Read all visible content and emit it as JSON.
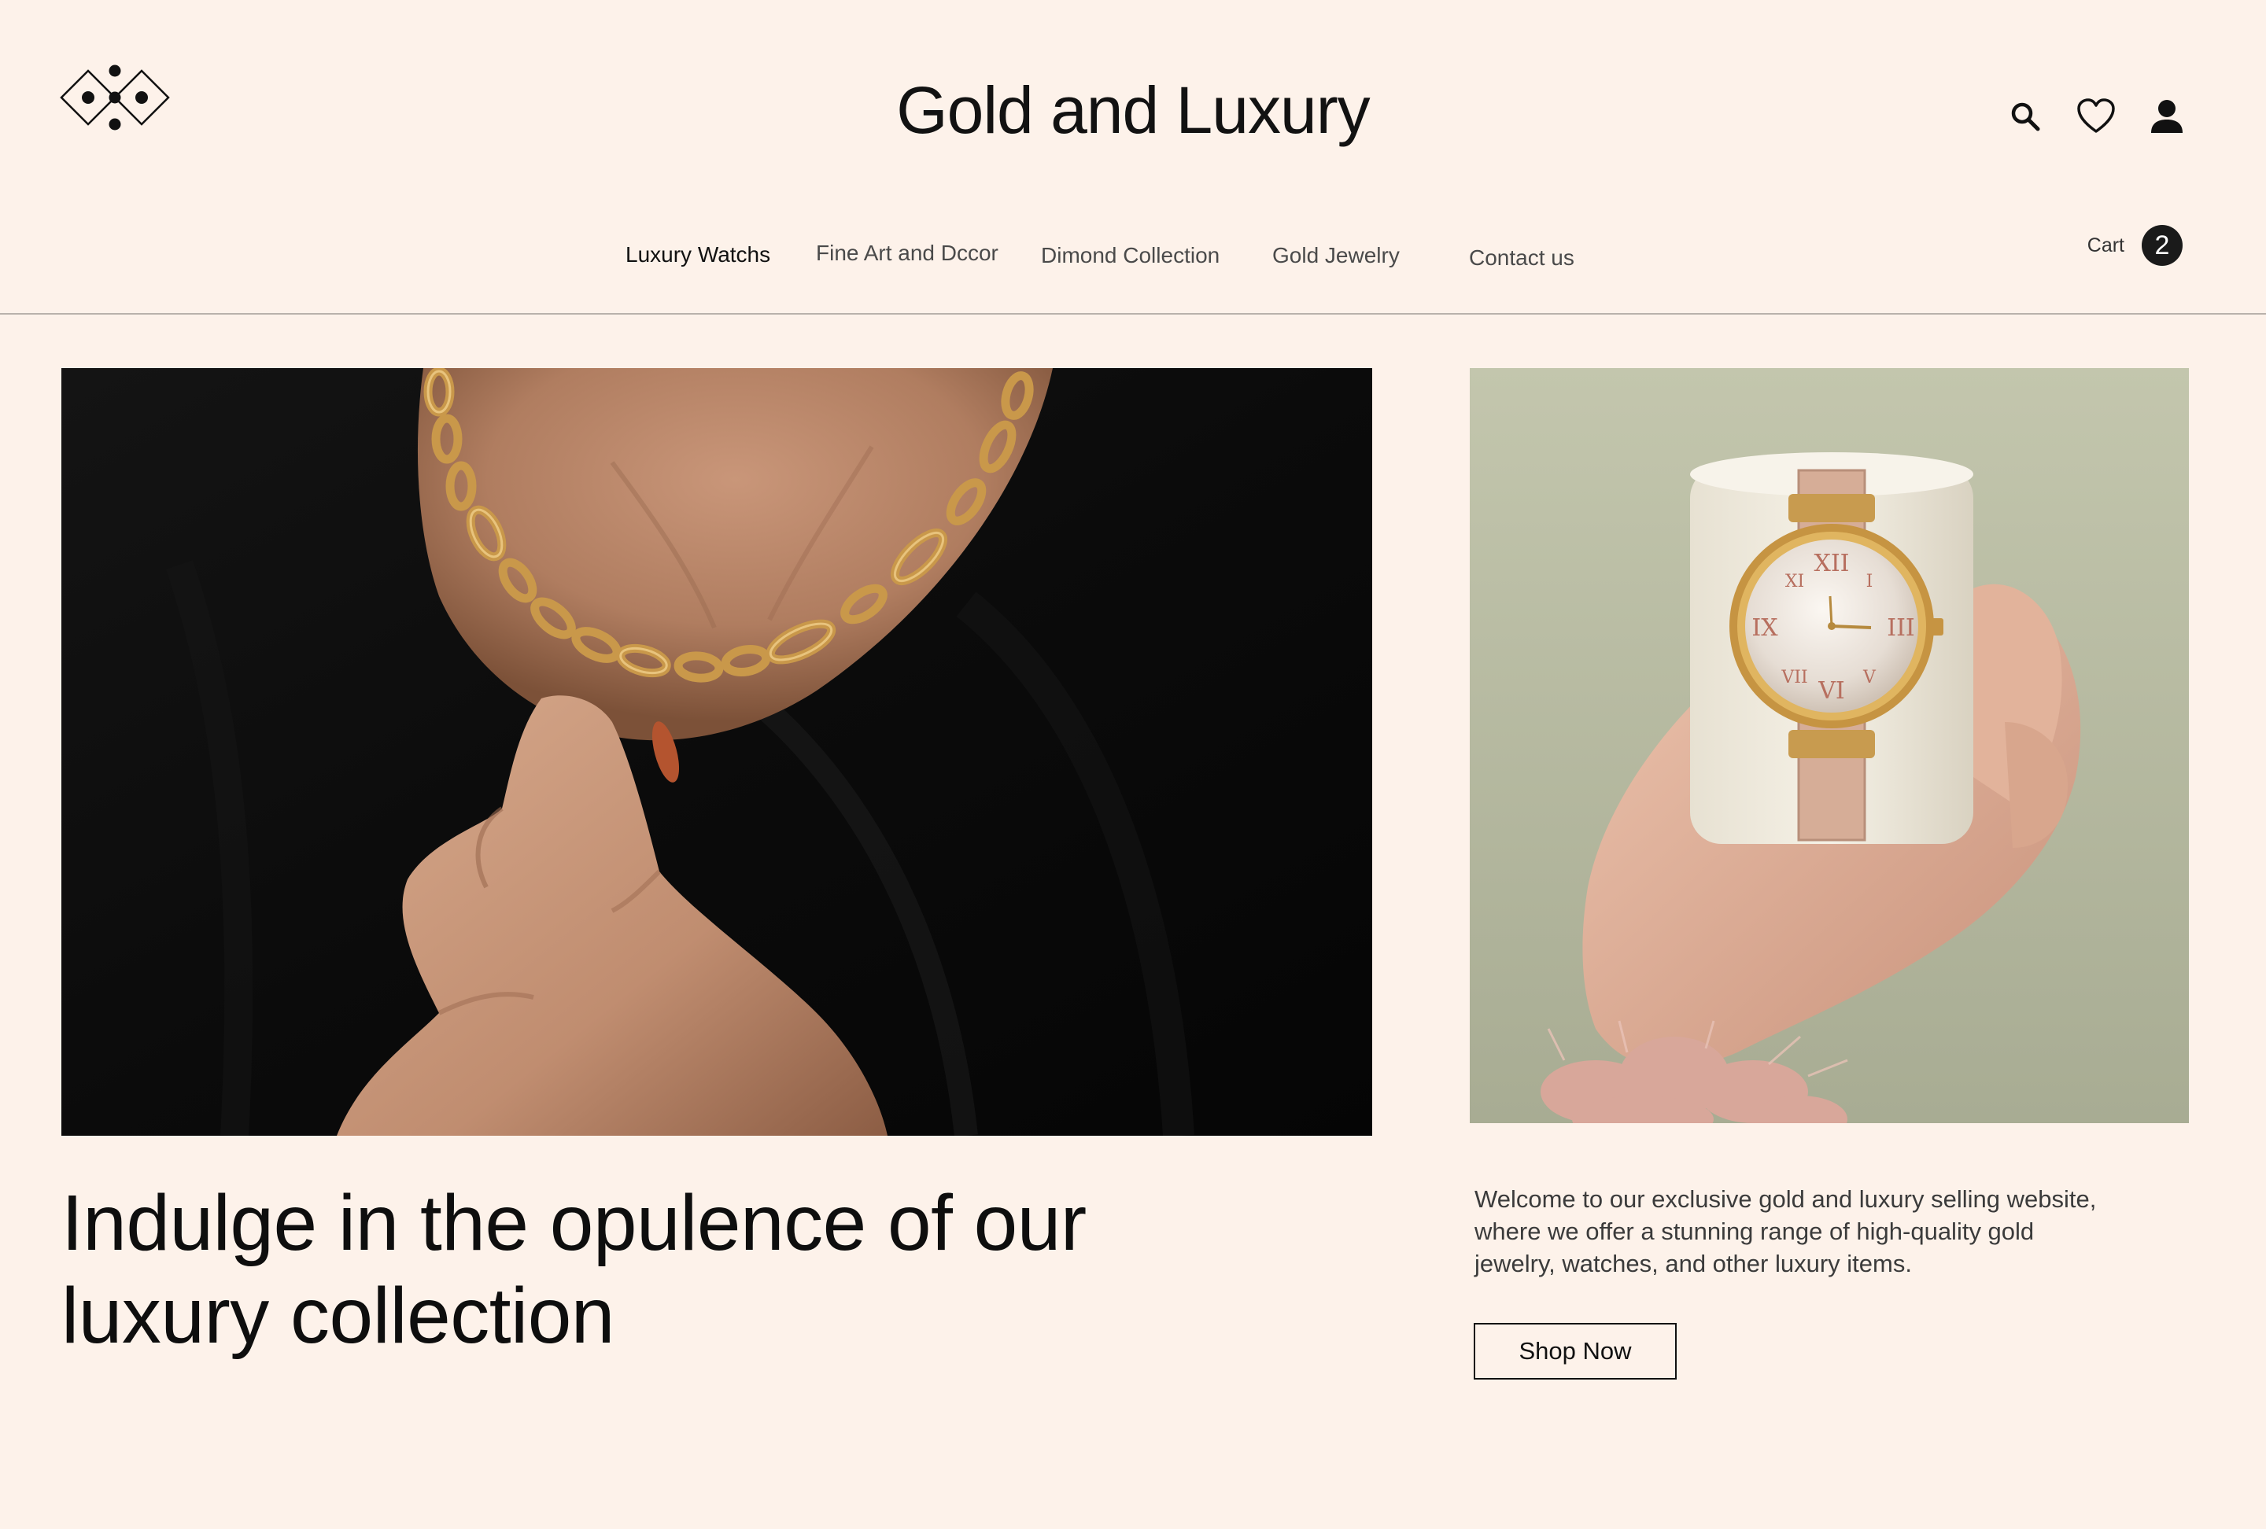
{
  "header": {
    "site_title": "Gold and Luxury",
    "icons": [
      "search-icon",
      "heart-icon",
      "user-icon"
    ]
  },
  "nav": {
    "items": [
      {
        "label": "Luxury Watchs",
        "active": true
      },
      {
        "label": "Fine Art and Dcсor",
        "active": false
      },
      {
        "label": "Dimond Collection",
        "active": false
      },
      {
        "label": "Gold Jewelry",
        "active": false
      },
      {
        "label": "Contact us",
        "active": false
      }
    ]
  },
  "cart": {
    "label": "Cart",
    "count": "2"
  },
  "hero": {
    "headline_line1": "Indulge in the opulence of our",
    "headline_line2": "luxury collection",
    "description": "Welcome to our exclusive gold and luxury selling website, where we offer a stunning range of high-quality gold jewelry, watches, and other luxury items.",
    "cta_label": "Shop Now"
  },
  "colors": {
    "background": "#fdf2ea",
    "text": "#111111",
    "divider": "#b9b2ac",
    "cart_badge": "#1a1a1a"
  }
}
